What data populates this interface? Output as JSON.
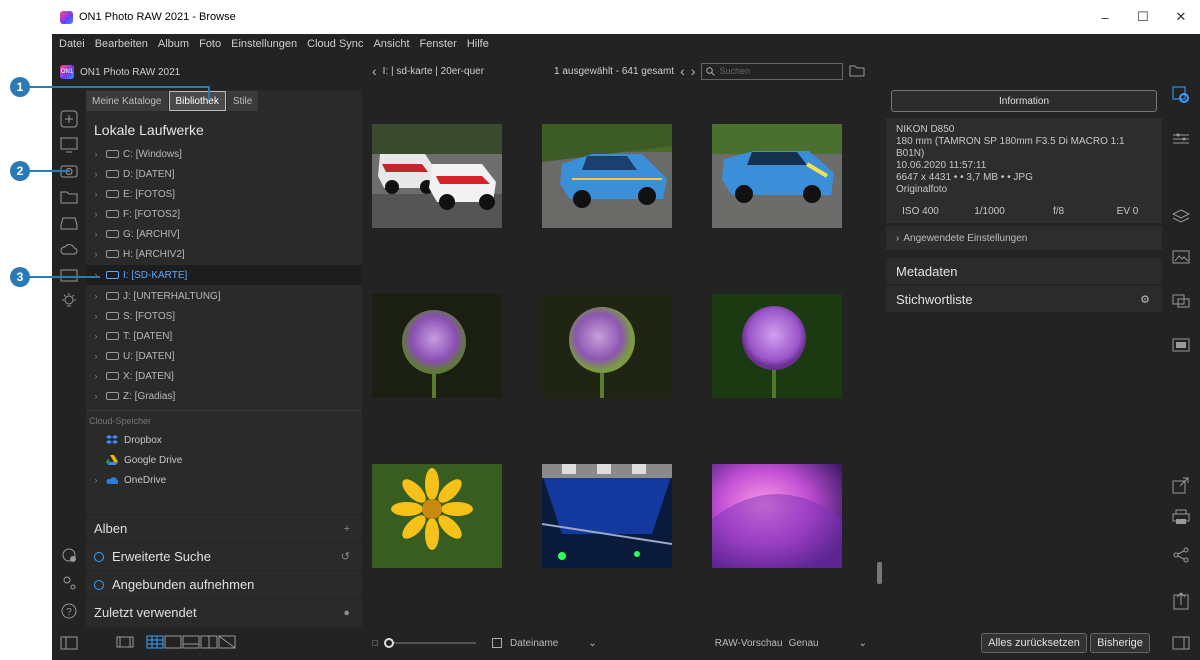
{
  "window": {
    "title": "ON1 Photo RAW 2021 - Browse",
    "minimize": "–",
    "maximize": "☐",
    "close": "✕"
  },
  "menu": [
    "Datei",
    "Bearbeiten",
    "Album",
    "Foto",
    "Einstellungen",
    "Cloud Sync",
    "Ansicht",
    "Fenster",
    "Hilfe"
  ],
  "panel": {
    "logo_text": "ON1",
    "app_name": "ON1 Photo RAW 2021",
    "tabs": [
      "Meine Kataloge",
      "Bibliothek",
      "Stile"
    ],
    "local_drives_title": "Lokale Laufwerke",
    "drives": [
      "C: [Windows]",
      "D: [DATEN]",
      "E: [FOTOS]",
      "F: [FOTOS2]",
      "G: [ARCHIV]",
      "H: [ARCHIV2]",
      "I: [SD-KARTE]",
      "J: [UNTERHALTUNG]",
      "S: [FOTOS]",
      "T: [DATEN]",
      "U: [DATEN]",
      "X: [DATEN]",
      "Z: [Gradias]"
    ],
    "cloud_label": "Cloud-Speicher",
    "cloud": [
      "Dropbox",
      "Google Drive",
      "OneDrive"
    ],
    "albums": "Alben",
    "advanced_search": "Erweiterte Suche",
    "tethered": "Angebunden aufnehmen",
    "recent": "Zuletzt verwendet"
  },
  "browser": {
    "path": "I: | sd-karte | 20er-quer",
    "count": "1 ausgewählt - 641 gesamt",
    "search_placeholder": "Suchen",
    "sort_label": "Dateiname",
    "preview_label": "RAW-Vorschau",
    "preview_value": "Genau"
  },
  "info": {
    "header": "Information",
    "camera": "NIKON D850",
    "lens": "180 mm (TAMRON SP 180mm F3.5 Di MACRO 1:1 B01N)",
    "datetime": "10.06.2020 11:57:11",
    "size": "6647 x 4431 • • 3,7 MB • • JPG",
    "type": "Originalfoto",
    "iso": "ISO 400",
    "shutter": "1/1000",
    "aperture": "f/8",
    "ev": "EV 0",
    "applied": "Angewendete Einstellungen",
    "metadata": "Metadaten",
    "keywords": "Stichwortliste"
  },
  "buttons": {
    "reset_all": "Alles zurücksetzen",
    "previous": "Bisherige"
  },
  "callouts": [
    "1",
    "2",
    "3"
  ],
  "colors": {
    "accent": "#3aa0ff",
    "callout": "#2a7ab6",
    "background": "#232324"
  }
}
